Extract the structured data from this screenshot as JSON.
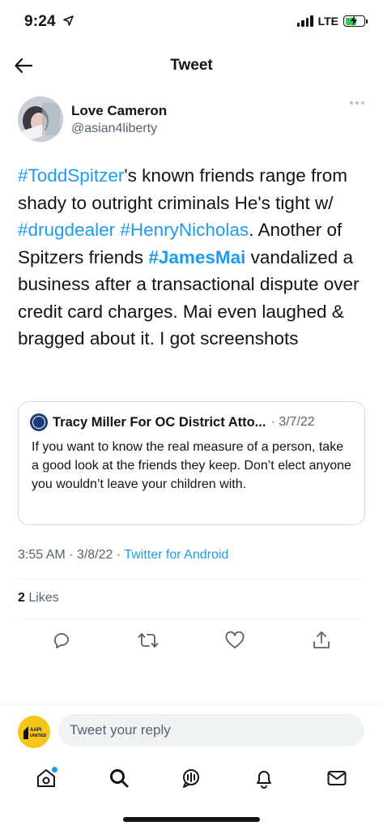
{
  "status_bar": {
    "time": "9:24",
    "network": "LTE",
    "battery_level": 0.6,
    "battery_color": "#34c759"
  },
  "nav": {
    "back_icon": "arrow-left-icon",
    "title": "Tweet"
  },
  "tweet": {
    "author_name": "Love Cameron",
    "author_handle": "@asian4liberty",
    "body": [
      {
        "text": "#ToddSpitzer",
        "type": "hashtag"
      },
      {
        "text": "'s known friends range from shady to outright criminals He's tight w/ ",
        "type": "text"
      },
      {
        "text": "#drugdealer",
        "type": "hashtag"
      },
      {
        "text": " ",
        "type": "text"
      },
      {
        "text": "#HenryNicholas",
        "type": "hashtag"
      },
      {
        "text": ". Another of Spitzers friends ",
        "type": "text"
      },
      {
        "text": "#JamesMai",
        "type": "hashtag-bold"
      },
      {
        "text": " vandalized a business after a transactional dispute over credit card charges. Mai even laughed & bragged about it. I got screenshots",
        "type": "text"
      }
    ],
    "quote": {
      "name": "Tracy Miller For OC District Atto...",
      "date": "· 3/7/22",
      "text": "If you want to know the real measure of a person, take a good look at the friends they keep. Don’t elect anyone you wouldn’t leave your children with."
    },
    "time": "3:55 AM · 3/8/22 · ",
    "source": "Twitter for Android",
    "likes_count": "2",
    "likes_label": " Likes"
  },
  "actions": [
    {
      "name": "reply-icon"
    },
    {
      "name": "retweet-icon"
    },
    {
      "name": "like-icon"
    },
    {
      "name": "share-icon"
    }
  ],
  "reply": {
    "placeholder": "Tweet your reply",
    "avatar_text": "AAPI\nUNITED"
  },
  "tabs": [
    {
      "name": "home-icon"
    },
    {
      "name": "search-icon"
    },
    {
      "name": "spaces-icon"
    },
    {
      "name": "notifications-icon"
    },
    {
      "name": "messages-icon"
    }
  ],
  "colors": {
    "accent": "#1d9bf0",
    "text": "#0f1419",
    "secondary": "#536471",
    "border": "#cfd9de"
  }
}
